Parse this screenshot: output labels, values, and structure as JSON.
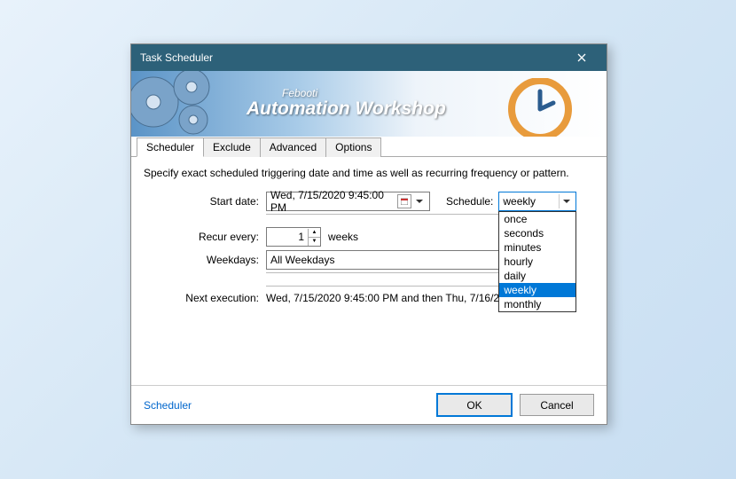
{
  "titlebar": {
    "title": "Task Scheduler"
  },
  "banner": {
    "line1": "Febooti",
    "line2": "Automation Workshop"
  },
  "tabs": [
    {
      "label": "Scheduler",
      "active": true
    },
    {
      "label": "Exclude",
      "active": false
    },
    {
      "label": "Advanced",
      "active": false
    },
    {
      "label": "Options",
      "active": false
    }
  ],
  "instruction": "Specify exact scheduled triggering date and time as well as recurring frequency or pattern.",
  "labels": {
    "start_date": "Start date:",
    "schedule": "Schedule:",
    "recur": "Recur every:",
    "weeks": "weeks",
    "weekdays": "Weekdays:",
    "next_exec": "Next execution:"
  },
  "values": {
    "start_date": "Wed,  7/15/2020  9:45:00 PM",
    "schedule_selected": "weekly",
    "recur_value": "1",
    "weekdays_value": "All Weekdays",
    "next_exec_value": "Wed, 7/15/2020 9:45:00 PM and then Thu, 7/16/2020 9:45:00 PM"
  },
  "schedule_options": [
    "once",
    "seconds",
    "minutes",
    "hourly",
    "daily",
    "weekly",
    "monthly"
  ],
  "footer": {
    "link": "Scheduler",
    "ok": "OK",
    "cancel": "Cancel"
  }
}
